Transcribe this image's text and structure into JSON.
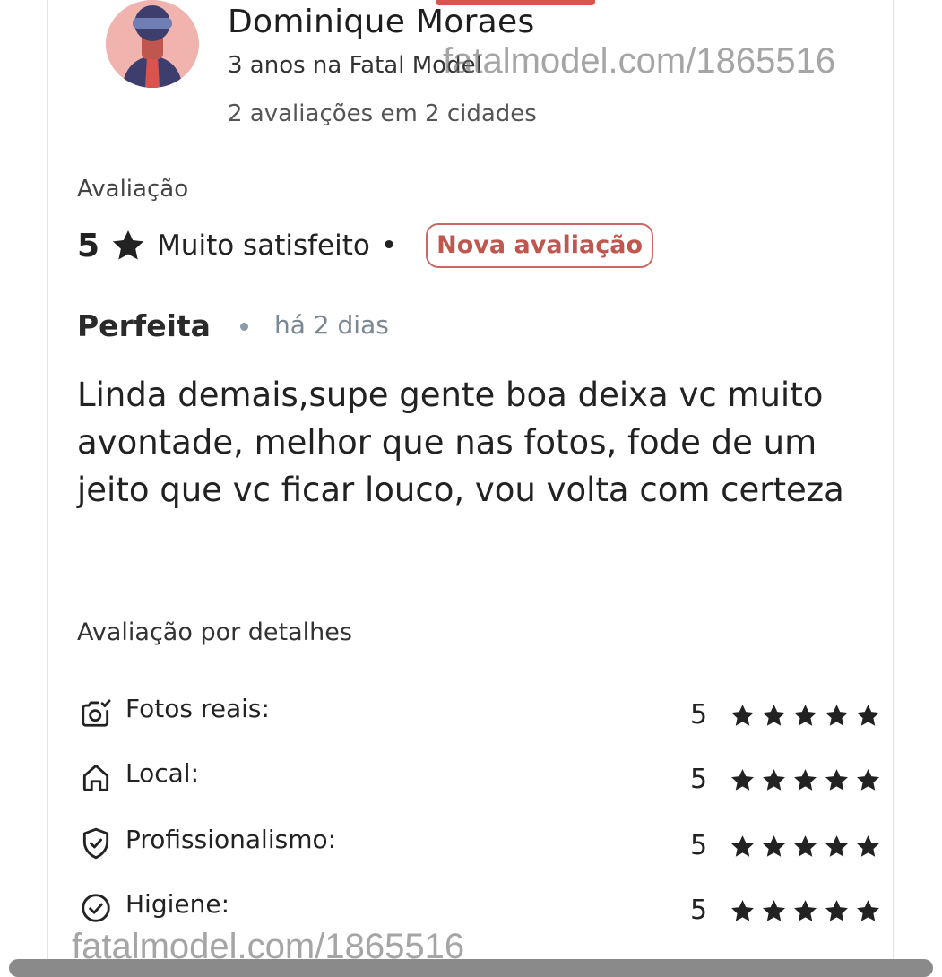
{
  "reviewer": {
    "name": "Dominique Moraes",
    "tenure": "3 anos na Fatal Model",
    "summary": "2 avaliações em 2 cidades"
  },
  "watermark": {
    "top": "fatalmodel.com/1865516",
    "bottom": "fatalmodel.com/1865516"
  },
  "review": {
    "section_label": "Avaliação",
    "score": "5",
    "score_icon": "star-icon",
    "sentiment": "Muito satisfeito",
    "separator": "•",
    "badge": "Nova avaliação",
    "title": "Perfeita",
    "date": "há 2 dias",
    "text": "Linda demais,supe gente boa deixa vc muito avontade, melhor que nas fotos, fode de um jeito que vc ficar louco, vou volta com certeza"
  },
  "details": {
    "title": "Avaliação por detalhes",
    "items": [
      {
        "label": "Fotos reais:",
        "value": "5",
        "stars": 5,
        "icon": "camera-check-icon"
      },
      {
        "label": "Local:",
        "value": "5",
        "stars": 5,
        "icon": "home-icon"
      },
      {
        "label": "Profissionalismo:",
        "value": "5",
        "stars": 5,
        "icon": "shield-check-icon"
      },
      {
        "label": "Higiene:",
        "value": "5",
        "stars": 5,
        "icon": "check-circle-icon"
      }
    ]
  },
  "colors": {
    "badge": "#c0574f",
    "top_tab": "#d9534f",
    "avatar_bg": "#f0b3ae",
    "text": "#222222",
    "muted": "#7a8894"
  }
}
